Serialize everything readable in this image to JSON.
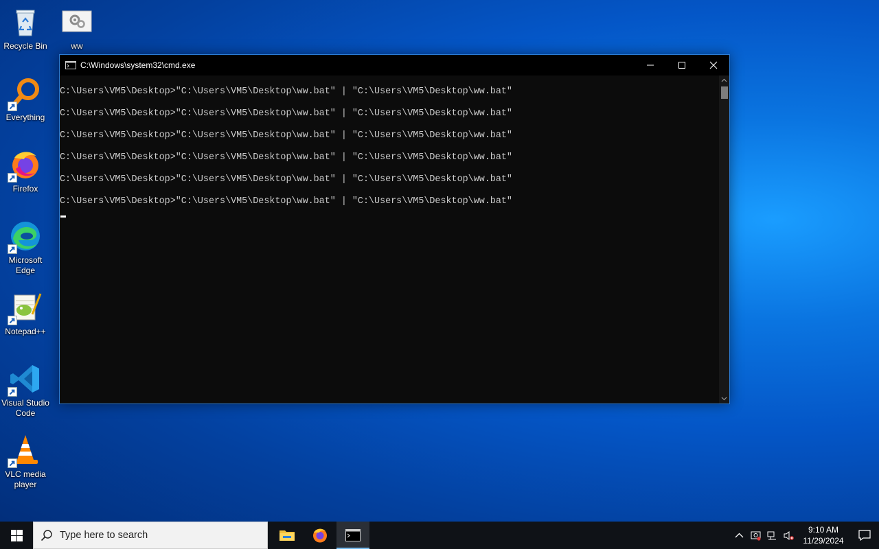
{
  "desktop": {
    "icons": [
      {
        "label": "Recycle Bin",
        "icon": "recycle-bin-icon"
      },
      {
        "label": "ww",
        "icon": "batch-file-icon"
      },
      {
        "label": "Everything",
        "icon": "everything-search-icon"
      },
      {
        "label": "Firefox",
        "icon": "firefox-icon"
      },
      {
        "label": "Microsoft Edge",
        "icon": "edge-icon"
      },
      {
        "label": "Notepad++",
        "icon": "notepadpp-icon"
      },
      {
        "label": "Visual Studio Code",
        "icon": "vscode-icon"
      },
      {
        "label": "VLC media player",
        "icon": "vlc-icon"
      }
    ]
  },
  "cmd_window": {
    "title": "C:\\Windows\\system32\\cmd.exe",
    "lines": [
      "C:\\Users\\VM5\\Desktop>\"C:\\Users\\VM5\\Desktop\\ww.bat\" | \"C:\\Users\\VM5\\Desktop\\ww.bat\"",
      "C:\\Users\\VM5\\Desktop>\"C:\\Users\\VM5\\Desktop\\ww.bat\" | \"C:\\Users\\VM5\\Desktop\\ww.bat\"",
      "C:\\Users\\VM5\\Desktop>\"C:\\Users\\VM5\\Desktop\\ww.bat\" | \"C:\\Users\\VM5\\Desktop\\ww.bat\"",
      "C:\\Users\\VM5\\Desktop>\"C:\\Users\\VM5\\Desktop\\ww.bat\" | \"C:\\Users\\VM5\\Desktop\\ww.bat\"",
      "C:\\Users\\VM5\\Desktop>\"C:\\Users\\VM5\\Desktop\\ww.bat\" | \"C:\\Users\\VM5\\Desktop\\ww.bat\"",
      "C:\\Users\\VM5\\Desktop>\"C:\\Users\\VM5\\Desktop\\ww.bat\" | \"C:\\Users\\VM5\\Desktop\\ww.bat\""
    ],
    "buttons": [
      "minimize",
      "maximize",
      "close"
    ]
  },
  "taskbar": {
    "search_placeholder": "Type here to search",
    "pinned": [
      {
        "name": "file-explorer",
        "icon": "folder-icon",
        "active": false
      },
      {
        "name": "firefox",
        "icon": "firefox-icon",
        "active": false
      },
      {
        "name": "command-prompt",
        "icon": "cmd-icon",
        "active": true
      }
    ],
    "clock": {
      "time": "9:10 AM",
      "date": "11/29/2024"
    }
  },
  "colors": {
    "cmd_bg": "#0c0c0c",
    "cmd_text": "#cccccc",
    "taskbar_bg": "#0f1217",
    "accent": "#76b9ed"
  }
}
